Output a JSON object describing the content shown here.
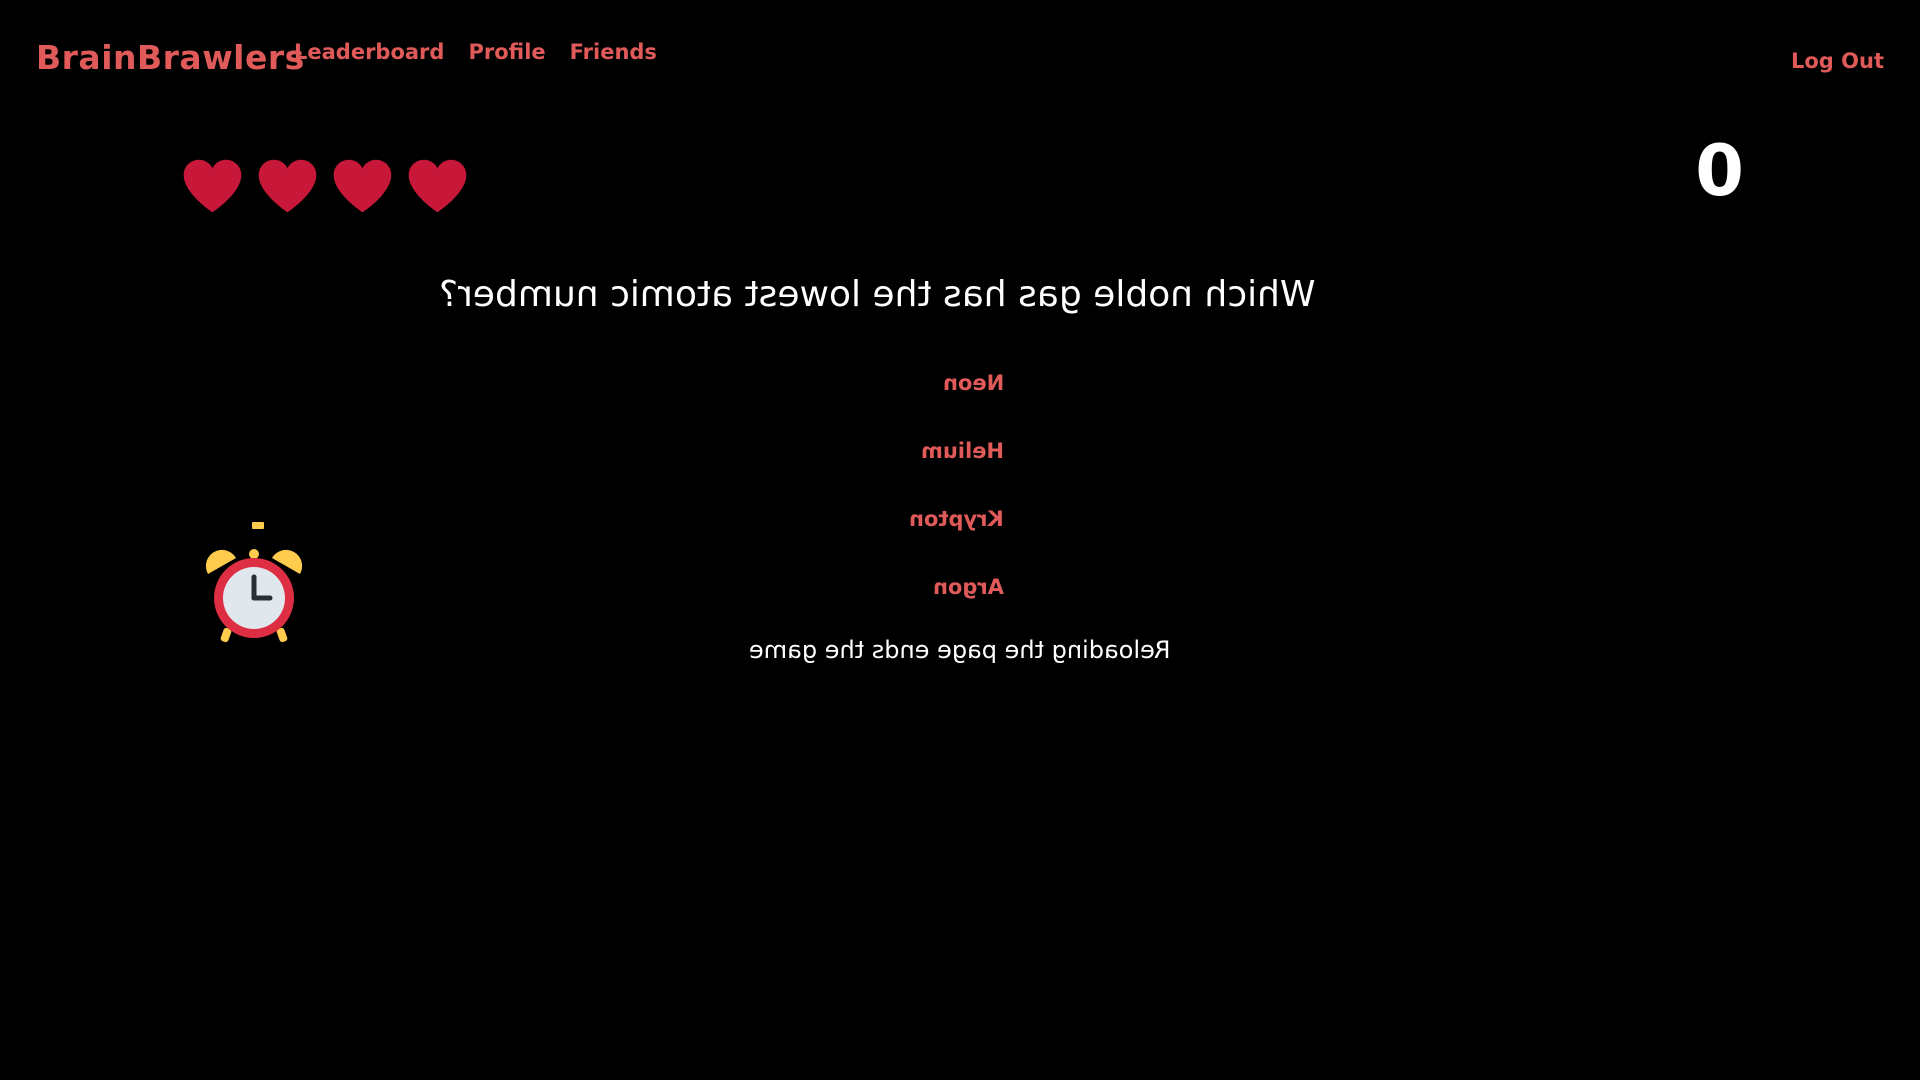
{
  "navbar": {
    "brand": "BrainBrawlers",
    "links": [
      "Leaderboard",
      "Profile",
      "Friends"
    ],
    "logout": "Log Out"
  },
  "game": {
    "lives": 4,
    "score": "0",
    "question": "Which noble gas has the lowest atomic number?",
    "answers": [
      "Neon",
      "Helium",
      "Krypton",
      "Argon"
    ],
    "notice": "Reloading the page ends the game",
    "text_mirrored": true
  },
  "icons": {
    "life": "heart-icon",
    "timer": "alarm-clock-icon"
  },
  "colors": {
    "background": "#000000",
    "accent": "#e05a5a",
    "heart": "#c8183a",
    "text": "#ffffff",
    "clock_bell": "#ffcc4d",
    "clock_body": "#dd2e44"
  }
}
